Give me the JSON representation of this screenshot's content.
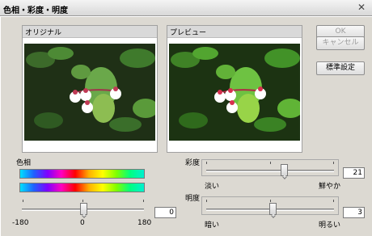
{
  "window": {
    "title": "色相・彩度・明度",
    "close_label": "✕"
  },
  "panels": {
    "original_label": "オリジナル",
    "preview_label": "プレビュー"
  },
  "buttons": {
    "ok": "OK",
    "cancel": "キャンセル",
    "default": "標準設定"
  },
  "hue": {
    "label": "色相",
    "min_label": "-180",
    "mid_label": "0",
    "max_label": "180",
    "value": "0",
    "level_fraction": 0.5
  },
  "saturation": {
    "label": "彩度",
    "min_label": "淡い",
    "max_label": "鮮やか",
    "value": "21",
    "level_fraction": 0.61
  },
  "lightness": {
    "label": "明度",
    "min_label": "暗い",
    "max_label": "明るい",
    "value": "3",
    "level_fraction": 0.52
  },
  "icons": {
    "close": "close-icon"
  }
}
